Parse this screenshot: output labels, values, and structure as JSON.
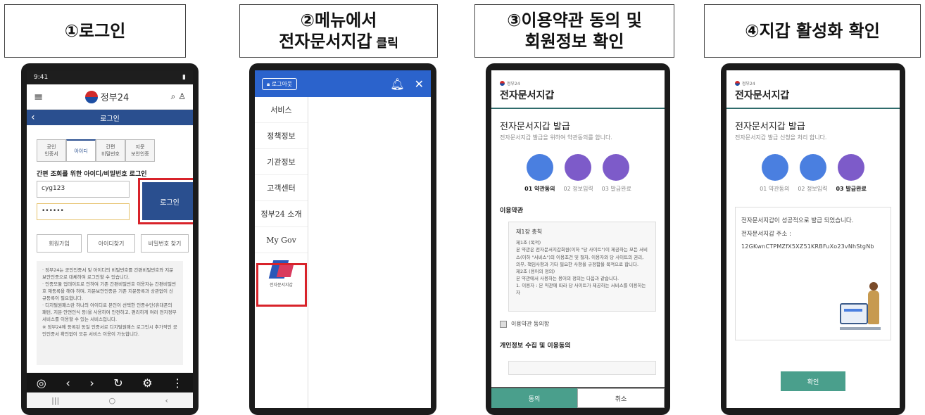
{
  "steps": [
    {
      "line1": "①로그인",
      "line2": "",
      "suffix": ""
    },
    {
      "line1": "②메뉴에서",
      "line2": "전자문서지갑",
      "suffix": " 클릭"
    },
    {
      "line1": "③이용약관 동의 및",
      "line2": "회원정보 확인",
      "suffix": ""
    },
    {
      "line1": "④지갑 활성화 확인",
      "line2": "",
      "suffix": ""
    }
  ],
  "phone1": {
    "status_time": "9:41",
    "logo": "정부24",
    "bar_title": "로그인",
    "tabs": [
      "공인\n인증서",
      "아이디",
      "간편\n비밀번호",
      "지문\n보안인증"
    ],
    "caption": "간편 조회를 위한 아이디/비밀번호 로그인",
    "id_value": "cyg123",
    "pw_value": "••••••",
    "login_btn": "로그인",
    "links": [
      "회원가입",
      "아이디찾기",
      "비밀번호 찾기"
    ],
    "notices": [
      "· 정부24는 공인인증서 및 아이디의 비밀번호를 간편비밀번호와 지문보안인증으로 대체하여 로그인할 수 있습니다.",
      "· 인증모듈 업데이트로 인하여 기존 간편비밀번호 이용자는 간편비밀번호 재등록을 해야 하며, 지문보안인증은 기존 지문등록과 상관없이 신규등록이 필요합니다.",
      "· 디지털원패스란 하나의 아이디로 본인이 선택한 인증수단(휴대폰의 패턴, 지문·안면인식 등)을 사용하여 안전하고, 편리하게 여러 전자정부 서비스를 이용할 수 있는 서비스입니다.",
      "※ 정부24에 등록된 동일 인증서로 디지털원패스 로그인시 추가적인 공인인증서 확인없이 모든 서비스 이용이 가능합니다."
    ]
  },
  "phone2": {
    "logout": "로그아웃",
    "menu": [
      "서비스",
      "정책정보",
      "기관정보",
      "고객센터",
      "정부24 소개",
      "My Gov"
    ],
    "wallet_caption": "전자문서지갑"
  },
  "phone3": {
    "logo_small": "정부24",
    "logo_big": "전자문서지갑",
    "title": "전자문서지갑 발급",
    "subtitle": "전자문서지갑 발급을 위하여 약관동의를 합니다.",
    "step_labels": [
      "01 약관동의",
      "02 정보입력",
      "03 발급완료"
    ],
    "section1": "이용약관",
    "terms_heading": "제1장 총칙",
    "terms_lines": [
      "제1조 (목적)",
      "본 약관은 전자문서지갑회원(이하 \"당 사이트\")이 제공하는 모든 서비스(이하 \"서비스\")의 이용조건 및 절차, 이용자와 당 사이트의 권리, 의무, 책임사항과 기타 필요한 사항을 규정함을 목적으로 합니다.",
      "제2조 (용어의 정의)",
      "본 약관에서 사용하는 용어의 정의는 다음과 같습니다.",
      "1. 이용자 : 본 약관에 따라 당 사이트가 제공하는 서비스를 이용하는 자"
    ],
    "agree": "이용약관 동의함",
    "section2": "개인정보 수집 및 이용동의",
    "btn_agree": "동의",
    "btn_cancel": "취소"
  },
  "phone4": {
    "logo_small": "정부24",
    "logo_big": "전자문서지갑",
    "title": "전자문서지갑 발급",
    "subtitle": "전자문서지갑 발급 신청을 처리 합니다.",
    "step_labels": [
      "01 약관동의",
      "02 정보입력",
      "03 발급완료"
    ],
    "result_line": "전자문서지갑이 성공적으로 발급 되었습니다.",
    "addr_label": "전자문서지갑 주소 :",
    "addr_value": "12GKwnCTPMZfX5XZ51KRBFuXo23vNhStgNb",
    "ok": "확인"
  }
}
